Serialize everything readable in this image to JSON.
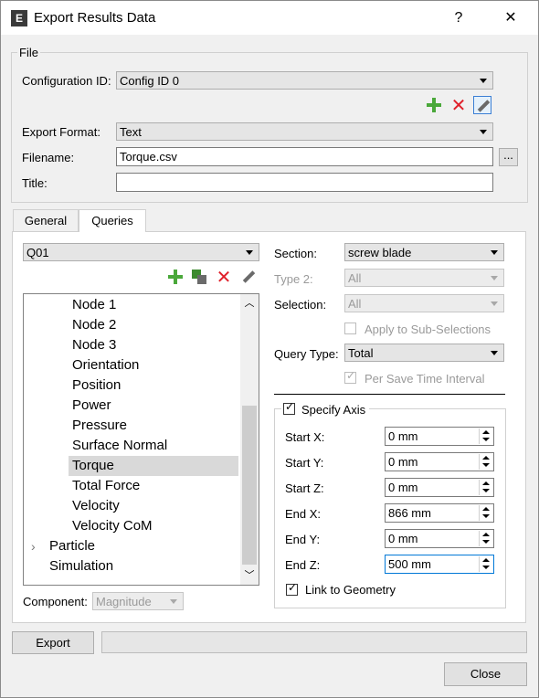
{
  "window": {
    "title": "Export Results Data",
    "help": "?",
    "close": "✕"
  },
  "file_group": {
    "label": "File",
    "config_label": "Configuration ID:",
    "config_value": "Config ID 0",
    "format_label": "Export Format:",
    "format_value": "Text",
    "filename_label": "Filename:",
    "filename_value": "Torque.csv",
    "browse": "...",
    "title_label": "Title:",
    "title_value": ""
  },
  "tabs": [
    {
      "label": "General"
    },
    {
      "label": "Queries"
    }
  ],
  "queries": {
    "query_value": "Q01",
    "tree": [
      {
        "label": "Node 1"
      },
      {
        "label": "Node 2"
      },
      {
        "label": "Node 3"
      },
      {
        "label": "Orientation"
      },
      {
        "label": "Position"
      },
      {
        "label": "Power"
      },
      {
        "label": "Pressure"
      },
      {
        "label": "Surface Normal"
      },
      {
        "label": "Torque"
      },
      {
        "label": "Total Force"
      },
      {
        "label": "Velocity"
      },
      {
        "label": "Velocity CoM"
      },
      {
        "label": "Particle"
      },
      {
        "label": "Simulation"
      }
    ],
    "component_label": "Component:",
    "component_value": "Magnitude"
  },
  "right": {
    "section_label": "Section:",
    "section_value": "screw blade",
    "type2_label": "Type 2:",
    "type2_value": "All",
    "selection_label": "Selection:",
    "selection_value": "All",
    "apply_sub": "Apply to Sub-Selections",
    "query_type_label": "Query Type:",
    "query_type_value": "Total",
    "per_save": "Per Save Time Interval",
    "specify_axis": "Specify Axis",
    "fields": [
      {
        "label": "Start X:",
        "value": "0 mm"
      },
      {
        "label": "Start Y:",
        "value": "0 mm"
      },
      {
        "label": "Start Z:",
        "value": "0 mm"
      },
      {
        "label": "End X:",
        "value": "866 mm"
      },
      {
        "label": "End Y:",
        "value": "0 mm"
      },
      {
        "label": "End Z:",
        "value": "500 mm"
      }
    ],
    "link_geometry": "Link to Geometry"
  },
  "bottom": {
    "export": "Export",
    "close": "Close"
  }
}
